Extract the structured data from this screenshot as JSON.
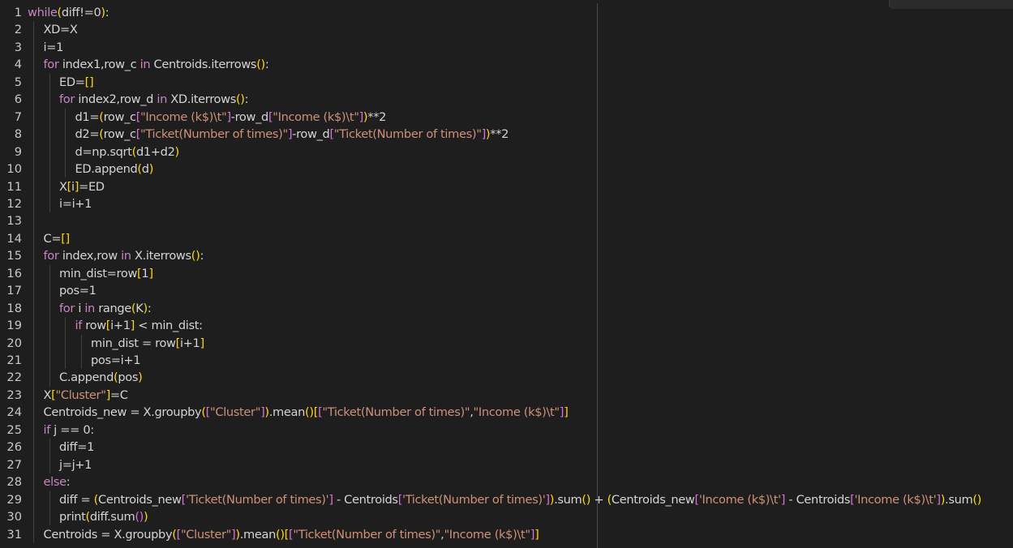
{
  "editor": {
    "lines": [
      {
        "n": "1",
        "indent": 0,
        "tokens": [
          [
            "kw",
            "while"
          ],
          [
            "br1",
            "("
          ],
          [
            "var",
            "diff!=0"
          ],
          [
            "br1",
            ")"
          ],
          [
            "var",
            ":"
          ]
        ]
      },
      {
        "n": "2",
        "indent": 1,
        "tokens": [
          [
            "var",
            "XD=X"
          ]
        ]
      },
      {
        "n": "3",
        "indent": 1,
        "tokens": [
          [
            "var",
            "i=1"
          ]
        ]
      },
      {
        "n": "4",
        "indent": 1,
        "tokens": [
          [
            "kw",
            "for"
          ],
          [
            "var",
            " index1,row_c "
          ],
          [
            "kw",
            "in"
          ],
          [
            "var",
            " Centroids.iterrows"
          ],
          [
            "br1",
            "()"
          ],
          [
            "var",
            ":"
          ]
        ]
      },
      {
        "n": "5",
        "indent": 2,
        "tokens": [
          [
            "var",
            "ED="
          ],
          [
            "br1",
            "[]"
          ]
        ]
      },
      {
        "n": "6",
        "indent": 2,
        "tokens": [
          [
            "kw",
            "for"
          ],
          [
            "var",
            " index2,row_d "
          ],
          [
            "kw",
            "in"
          ],
          [
            "var",
            " XD.iterrows"
          ],
          [
            "br1",
            "()"
          ],
          [
            "var",
            ":"
          ]
        ]
      },
      {
        "n": "7",
        "indent": 3,
        "tokens": [
          [
            "var",
            "d1="
          ],
          [
            "br1",
            "("
          ],
          [
            "var",
            "row_c"
          ],
          [
            "br2",
            "["
          ],
          [
            "str",
            "\"Income (k$)\\t\""
          ],
          [
            "br2",
            "]"
          ],
          [
            "var",
            "-row_d"
          ],
          [
            "br2",
            "["
          ],
          [
            "str",
            "\"Income (k$)\\t\""
          ],
          [
            "br2",
            "]"
          ],
          [
            "br1",
            ")"
          ],
          [
            "var",
            "**2"
          ]
        ]
      },
      {
        "n": "8",
        "indent": 3,
        "tokens": [
          [
            "var",
            "d2="
          ],
          [
            "br1",
            "("
          ],
          [
            "var",
            "row_c"
          ],
          [
            "br2",
            "["
          ],
          [
            "str",
            "\"Ticket(Number of times)\""
          ],
          [
            "br2",
            "]"
          ],
          [
            "var",
            "-row_d"
          ],
          [
            "br2",
            "["
          ],
          [
            "str",
            "\"Ticket(Number of times)\""
          ],
          [
            "br2",
            "]"
          ],
          [
            "br1",
            ")"
          ],
          [
            "var",
            "**2"
          ]
        ]
      },
      {
        "n": "9",
        "indent": 3,
        "tokens": [
          [
            "var",
            "d=np.sqrt"
          ],
          [
            "br1",
            "("
          ],
          [
            "var",
            "d1+d2"
          ],
          [
            "br1",
            ")"
          ]
        ]
      },
      {
        "n": "10",
        "indent": 3,
        "tokens": [
          [
            "var",
            "ED.append"
          ],
          [
            "br1",
            "("
          ],
          [
            "var",
            "d"
          ],
          [
            "br1",
            ")"
          ]
        ]
      },
      {
        "n": "11",
        "indent": 2,
        "tokens": [
          [
            "var",
            "X"
          ],
          [
            "br1",
            "["
          ],
          [
            "var",
            "i"
          ],
          [
            "br1",
            "]"
          ],
          [
            "var",
            "=ED"
          ]
        ]
      },
      {
        "n": "12",
        "indent": 2,
        "tokens": [
          [
            "var",
            "i=i+1"
          ]
        ]
      },
      {
        "n": "13",
        "indent": 1,
        "tokens": []
      },
      {
        "n": "14",
        "indent": 1,
        "tokens": [
          [
            "var",
            "C="
          ],
          [
            "br1",
            "[]"
          ]
        ]
      },
      {
        "n": "15",
        "indent": 1,
        "tokens": [
          [
            "kw",
            "for"
          ],
          [
            "var",
            " index,row "
          ],
          [
            "kw",
            "in"
          ],
          [
            "var",
            " X.iterrows"
          ],
          [
            "br1",
            "()"
          ],
          [
            "var",
            ":"
          ]
        ]
      },
      {
        "n": "16",
        "indent": 2,
        "tokens": [
          [
            "var",
            "min_dist=row"
          ],
          [
            "br1",
            "["
          ],
          [
            "var",
            "1"
          ],
          [
            "br1",
            "]"
          ]
        ]
      },
      {
        "n": "17",
        "indent": 2,
        "tokens": [
          [
            "var",
            "pos=1"
          ]
        ]
      },
      {
        "n": "18",
        "indent": 2,
        "tokens": [
          [
            "kw",
            "for"
          ],
          [
            "var",
            " i "
          ],
          [
            "kw",
            "in"
          ],
          [
            "var",
            " range"
          ],
          [
            "br1",
            "("
          ],
          [
            "var",
            "K"
          ],
          [
            "br1",
            ")"
          ],
          [
            "var",
            ":"
          ]
        ]
      },
      {
        "n": "19",
        "indent": 3,
        "tokens": [
          [
            "kw",
            "if"
          ],
          [
            "var",
            " row"
          ],
          [
            "br1",
            "["
          ],
          [
            "var",
            "i+1"
          ],
          [
            "br1",
            "]"
          ],
          [
            "var",
            " < min_dist:"
          ]
        ]
      },
      {
        "n": "20",
        "indent": 4,
        "tokens": [
          [
            "var",
            "min_dist = row"
          ],
          [
            "br1",
            "["
          ],
          [
            "var",
            "i+1"
          ],
          [
            "br1",
            "]"
          ]
        ]
      },
      {
        "n": "21",
        "indent": 4,
        "tokens": [
          [
            "var",
            "pos=i+1"
          ]
        ]
      },
      {
        "n": "22",
        "indent": 2,
        "tokens": [
          [
            "var",
            "C.append"
          ],
          [
            "br1",
            "("
          ],
          [
            "var",
            "pos"
          ],
          [
            "br1",
            ")"
          ]
        ]
      },
      {
        "n": "23",
        "indent": 1,
        "tokens": [
          [
            "var",
            "X"
          ],
          [
            "br1",
            "["
          ],
          [
            "str",
            "\"Cluster\""
          ],
          [
            "br1",
            "]"
          ],
          [
            "var",
            "=C"
          ]
        ]
      },
      {
        "n": "24",
        "indent": 1,
        "tokens": [
          [
            "var",
            "Centroids_new = X.groupby"
          ],
          [
            "br1",
            "("
          ],
          [
            "br2",
            "["
          ],
          [
            "str",
            "\"Cluster\""
          ],
          [
            "br2",
            "]"
          ],
          [
            "br1",
            ")"
          ],
          [
            "var",
            ".mean"
          ],
          [
            "br1",
            "()"
          ],
          [
            "br1",
            "["
          ],
          [
            "br2",
            "["
          ],
          [
            "str",
            "\"Ticket(Number of times)\""
          ],
          [
            "var",
            ","
          ],
          [
            "str",
            "\"Income (k$)\\t\""
          ],
          [
            "br2",
            "]"
          ],
          [
            "br1",
            "]"
          ]
        ]
      },
      {
        "n": "25",
        "indent": 1,
        "tokens": [
          [
            "kw",
            "if"
          ],
          [
            "var",
            " j == 0:"
          ]
        ]
      },
      {
        "n": "26",
        "indent": 2,
        "tokens": [
          [
            "var",
            "diff=1"
          ]
        ]
      },
      {
        "n": "27",
        "indent": 2,
        "tokens": [
          [
            "var",
            "j=j+1"
          ]
        ]
      },
      {
        "n": "28",
        "indent": 1,
        "tokens": [
          [
            "kw",
            "else"
          ],
          [
            "var",
            ":"
          ]
        ]
      },
      {
        "n": "29",
        "indent": 2,
        "tokens": [
          [
            "var",
            "diff = "
          ],
          [
            "br1",
            "("
          ],
          [
            "var",
            "Centroids_new"
          ],
          [
            "br2",
            "["
          ],
          [
            "str",
            "'Ticket(Number of times)'"
          ],
          [
            "br2",
            "]"
          ],
          [
            "var",
            " - Centroids"
          ],
          [
            "br2",
            "["
          ],
          [
            "str",
            "'Ticket(Number of times)'"
          ],
          [
            "br2",
            "]"
          ],
          [
            "br1",
            ")"
          ],
          [
            "var",
            ".sum"
          ],
          [
            "br1",
            "()"
          ],
          [
            "var",
            " + "
          ],
          [
            "br1",
            "("
          ],
          [
            "var",
            "Centroids_new"
          ],
          [
            "br2",
            "["
          ],
          [
            "str",
            "'Income (k$)\\t'"
          ],
          [
            "br2",
            "]"
          ],
          [
            "var",
            " - Centroids"
          ],
          [
            "br2",
            "["
          ],
          [
            "str",
            "'Income (k$)\\t'"
          ],
          [
            "br2",
            "]"
          ],
          [
            "br1",
            ")"
          ],
          [
            "var",
            ".sum"
          ],
          [
            "br1",
            "()"
          ]
        ]
      },
      {
        "n": "30",
        "indent": 2,
        "tokens": [
          [
            "var",
            "print"
          ],
          [
            "br1",
            "("
          ],
          [
            "var",
            "diff.sum"
          ],
          [
            "br2",
            "()"
          ],
          [
            "br1",
            ")"
          ]
        ]
      },
      {
        "n": "31",
        "indent": 1,
        "tokens": [
          [
            "var",
            "Centroids = X.groupby"
          ],
          [
            "br1",
            "("
          ],
          [
            "br2",
            "["
          ],
          [
            "str",
            "\"Cluster\""
          ],
          [
            "br2",
            "]"
          ],
          [
            "br1",
            ")"
          ],
          [
            "var",
            ".mean"
          ],
          [
            "br1",
            "()"
          ],
          [
            "br1",
            "["
          ],
          [
            "br2",
            "["
          ],
          [
            "str",
            "\"Ticket(Number of times)\""
          ],
          [
            "var",
            ","
          ],
          [
            "str",
            "\"Income (k$)\\t\""
          ],
          [
            "br2",
            "]"
          ],
          [
            "br1",
            "]"
          ]
        ]
      }
    ]
  }
}
